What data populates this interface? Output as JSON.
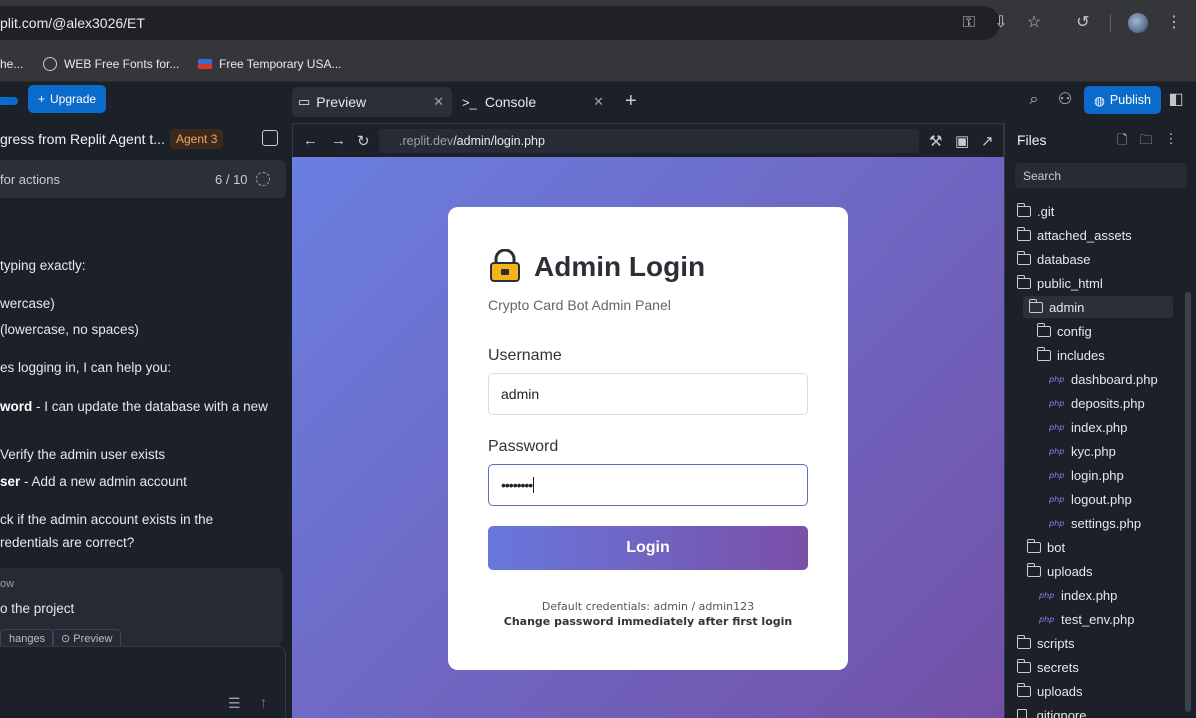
{
  "browser": {
    "url": "plit.com/@alex3026/ET",
    "bookmarks": [
      {
        "label": "he..."
      },
      {
        "label": "WEB Free Fonts for..."
      },
      {
        "label": "Free Temporary USA..."
      }
    ]
  },
  "agent": {
    "upgrade_label": "Upgrade",
    "title": "gress from Replit Agent t...",
    "badge": "Agent 3",
    "progress_label": "for actions",
    "progress_count": "6 / 10",
    "messages": [
      {
        "pre": "",
        "bold": "",
        "text": "typing exactly:"
      },
      {
        "pre": "",
        "bold": "",
        "text": "wercase)"
      },
      {
        "pre": "",
        "bold": "",
        "text": "(lowercase, no spaces)"
      },
      {
        "pre": "",
        "bold": "",
        "text": "es logging in, I can help you:"
      },
      {
        "pre": "",
        "bold": "word",
        "text": " - I can update the database with a new"
      },
      {
        "pre": "",
        "bold": "",
        "text": " Verify the admin user exists"
      },
      {
        "pre": "",
        "bold": "ser",
        "text": " - Add a new admin account"
      },
      {
        "pre": "",
        "bold": "",
        "text": "ck if the admin account exists in the"
      },
      {
        "pre": "",
        "bold": "",
        "text": "redentials are correct?"
      }
    ],
    "action_card": {
      "line1": "ow",
      "line2": "o the project",
      "chip1": "hanges",
      "chip2": "Preview"
    }
  },
  "preview": {
    "tab_preview": "Preview",
    "tab_console": "Console",
    "address_host": ".replit.dev",
    "address_path": "/admin/login.php"
  },
  "login": {
    "title": "Admin Login",
    "subtitle": "Crypto Card Bot Admin Panel",
    "username_label": "Username",
    "username_value": "admin",
    "password_label": "Password",
    "password_value": "••••••••",
    "button": "Login",
    "note1": "Default credentials: admin / admin123",
    "note2": "Change password immediately after first login"
  },
  "topbar": {
    "publish_label": "Publish"
  },
  "files": {
    "header": "Files",
    "search_placeholder": "Search",
    "items": [
      {
        "name": ".git",
        "type": "folder",
        "depth": 0
      },
      {
        "name": "attached_assets",
        "type": "folder",
        "depth": 0
      },
      {
        "name": "database",
        "type": "folder",
        "depth": 0
      },
      {
        "name": "public_html",
        "type": "folder",
        "depth": 0
      },
      {
        "name": "admin",
        "type": "folder",
        "depth": 1
      },
      {
        "name": "config",
        "type": "folder",
        "depth": 2
      },
      {
        "name": "includes",
        "type": "folder",
        "depth": 2
      },
      {
        "name": "dashboard.php",
        "type": "php",
        "depth": 2
      },
      {
        "name": "deposits.php",
        "type": "php",
        "depth": 2
      },
      {
        "name": "index.php",
        "type": "php",
        "depth": 2
      },
      {
        "name": "kyc.php",
        "type": "php",
        "depth": 2
      },
      {
        "name": "login.php",
        "type": "php",
        "depth": 2
      },
      {
        "name": "logout.php",
        "type": "php",
        "depth": 2
      },
      {
        "name": "settings.php",
        "type": "php",
        "depth": 2
      },
      {
        "name": "bot",
        "type": "folder",
        "depth": 1
      },
      {
        "name": "uploads",
        "type": "folder",
        "depth": 1
      },
      {
        "name": "index.php",
        "type": "php",
        "depth": 1
      },
      {
        "name": "test_env.php",
        "type": "php",
        "depth": 1
      },
      {
        "name": "scripts",
        "type": "folder",
        "depth": 0
      },
      {
        "name": "secrets",
        "type": "folder",
        "depth": 0
      },
      {
        "name": "uploads",
        "type": "folder",
        "depth": 0
      },
      {
        "name": ".gitignore",
        "type": "file",
        "depth": 0
      }
    ]
  }
}
